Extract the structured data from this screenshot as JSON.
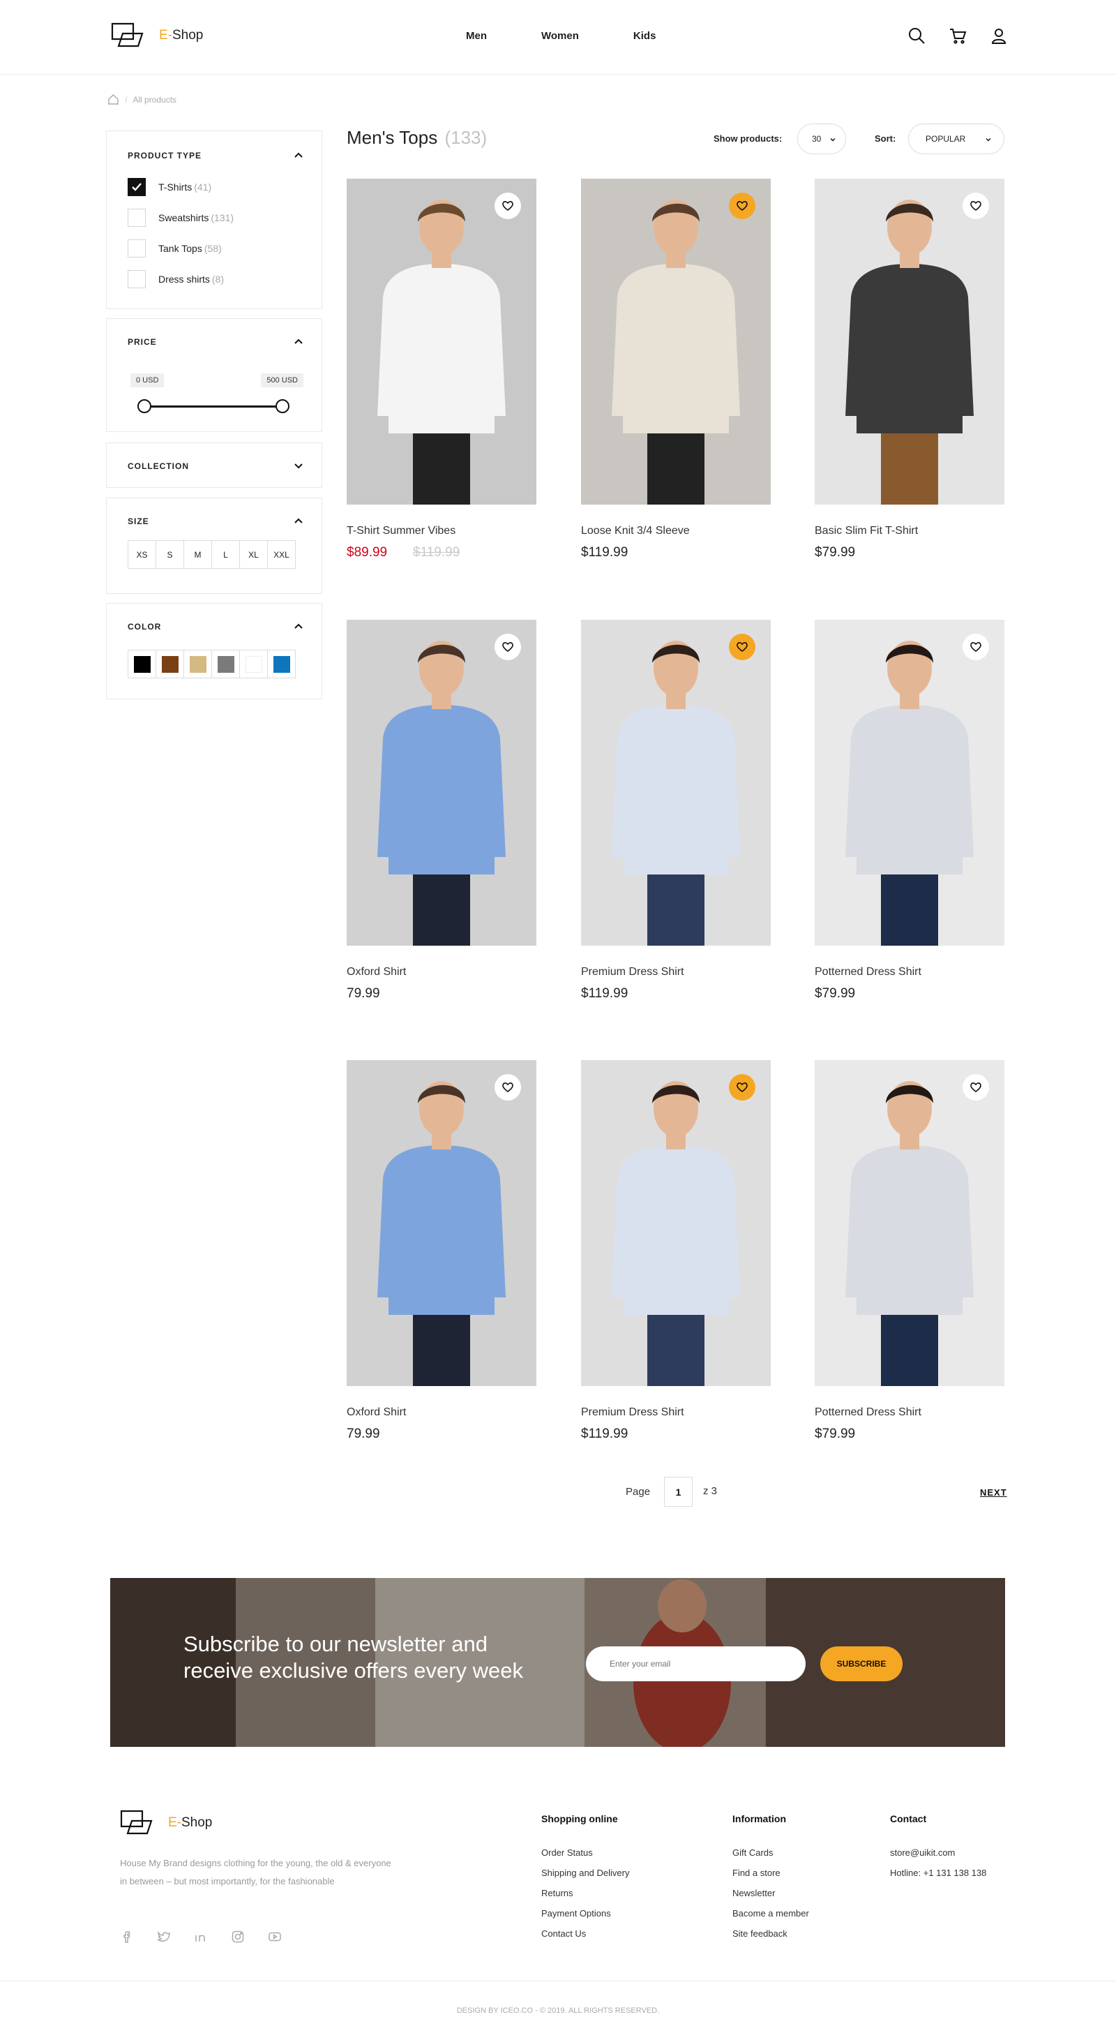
{
  "header": {
    "brand_prefix": "E-",
    "brand_name": "Shop",
    "nav": [
      "Men",
      "Women",
      "Kids"
    ],
    "icons": [
      "search-icon",
      "cart-icon",
      "user-icon"
    ]
  },
  "breadcrumb": {
    "current": "All products"
  },
  "filters": {
    "product_type": {
      "title": "PRODUCT TYPE",
      "items": [
        {
          "label": "T-Shirts",
          "count": "(41)",
          "checked": true
        },
        {
          "label": "Sweatshirts",
          "count": "(131)",
          "checked": false
        },
        {
          "label": "Tank Tops",
          "count": "(58)",
          "checked": false
        },
        {
          "label": "Dress shirts",
          "count": "(8)",
          "checked": false
        }
      ]
    },
    "price": {
      "title": "PRICE",
      "min": "0 USD",
      "max": "500 USD"
    },
    "collection": {
      "title": "COLLECTION"
    },
    "size": {
      "title": "SIZE",
      "options": [
        "XS",
        "S",
        "M",
        "L",
        "XL",
        "XXL"
      ]
    },
    "color": {
      "title": "COLOR",
      "swatches": [
        "#000000",
        "#7b3f16",
        "#d4b983",
        "#7a7a7a",
        "#ffffff",
        "#0f75bc"
      ]
    }
  },
  "listing": {
    "title": "Men's Tops",
    "count": "(133)",
    "show_label": "Show products:",
    "show_value": "30",
    "sort_label": "Sort:",
    "sort_value": "POPULAR"
  },
  "products": [
    {
      "name": "T-Shirt Summer Vibes",
      "price": "$89.99",
      "old_price": "$119.99",
      "favorite": false
    },
    {
      "name": "Loose Knit 3/4 Sleeve",
      "price": "$119.99",
      "favorite": true
    },
    {
      "name": "Basic Slim Fit T-Shirt",
      "price": "$79.99",
      "favorite": false
    },
    {
      "name": "Oxford Shirt",
      "price": "79.99",
      "favorite": false
    },
    {
      "name": "Premium Dress Shirt",
      "price": "$119.99",
      "favorite": true
    },
    {
      "name": "Potterned Dress Shirt",
      "price": "$79.99",
      "favorite": false
    },
    {
      "name": "Oxford Shirt",
      "price": "79.99",
      "favorite": false
    },
    {
      "name": "Premium Dress Shirt",
      "price": "$119.99",
      "favorite": true
    },
    {
      "name": "Potterned Dress Shirt",
      "price": "$79.99",
      "favorite": false
    }
  ],
  "pagination": {
    "page_label": "Page",
    "current": "1",
    "of": "z 3",
    "next": "NEXT"
  },
  "newsletter": {
    "title": "Subscribe to our newsletter and receive exclusive offers every week",
    "placeholder": "Enter your email",
    "button": "SUBSCRIBE"
  },
  "footer": {
    "description": "House My Brand designs clothing for the young, the old & everyone in between – but most importantly, for the fashionable",
    "socials": [
      "facebook-icon",
      "twitter-icon",
      "linkedin-icon",
      "instagram-icon",
      "youtube-icon"
    ],
    "col1": {
      "title": "Shopping online",
      "links": [
        "Order Status",
        "Shipping and Delivery",
        "Returns",
        "Payment Options",
        "Contact Us"
      ]
    },
    "col2": {
      "title": "Information",
      "links": [
        "Gift Cards",
        "Find a store",
        "Newsletter",
        "Bacome a member",
        "Site feedback"
      ]
    },
    "col3": {
      "title": "Contact",
      "links": [
        "store@uikit.com",
        "Hotline: +1 131 138 138"
      ]
    },
    "copyright": "DESIGN BY ICEO.CO - © 2019. ALL RIGHTS RESERVED."
  },
  "colors": {
    "accent": "#f5a623",
    "sale": "#d0021b",
    "border": "#e8e8e8"
  }
}
